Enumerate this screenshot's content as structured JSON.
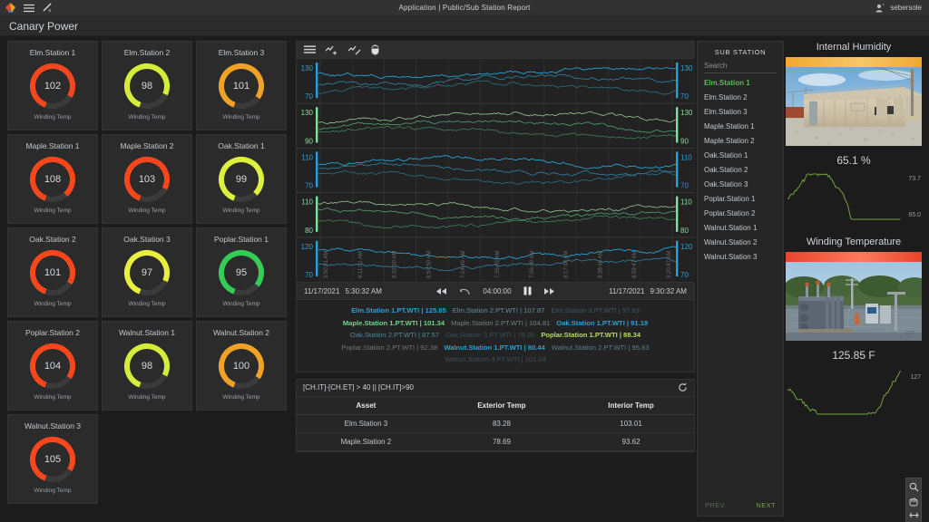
{
  "topbar": {
    "logo_icon": "canary-logo-icon",
    "menu_icon": "hamburger-menu-icon",
    "trend_icon": "trend-pen-icon",
    "title": "Application | Public/Sub Station Report",
    "user_icon": "user-account-icon",
    "user": "sebersole"
  },
  "app": {
    "title": "Canary Power"
  },
  "gauges": {
    "label": "Winding Temp",
    "items": [
      {
        "name": "Elm.Station 1",
        "value": "102",
        "color": "#f4471f",
        "pct": 78
      },
      {
        "name": "Elm.Station 2",
        "value": "98",
        "color": "#d6ec3a",
        "pct": 76
      },
      {
        "name": "Elm.Station 3",
        "value": "101",
        "color": "#f0a226",
        "pct": 79
      },
      {
        "name": "Maple.Station 1",
        "value": "108",
        "color": "#f9461c",
        "pct": 83
      },
      {
        "name": "Maple.Station 2",
        "value": "103",
        "color": "#f9461c",
        "pct": 77
      },
      {
        "name": "Oak.Station 1",
        "value": "99",
        "color": "#ddf03c",
        "pct": 82
      },
      {
        "name": "Oak.Station 2",
        "value": "101",
        "color": "#f9461c",
        "pct": 78
      },
      {
        "name": "Oak.Station 3",
        "value": "97",
        "color": "#e8ef3c",
        "pct": 76
      },
      {
        "name": "Poplar.Station 1",
        "value": "95",
        "color": "#33cc55",
        "pct": 80
      },
      {
        "name": "Poplar.Station 2",
        "value": "104",
        "color": "#f9461c",
        "pct": 79
      },
      {
        "name": "Walnut.Station 1",
        "value": "98",
        "color": "#d6ec3a",
        "pct": 77
      },
      {
        "name": "Walnut.Station 2",
        "value": "100",
        "color": "#f0a226",
        "pct": 79
      },
      {
        "name": "Walnut.Station 3",
        "value": "105",
        "color": "#f9461c",
        "pct": 78
      }
    ]
  },
  "trend": {
    "toolbar": {
      "menu_icon": "trend-menu-icon",
      "add_tag_icon": "add-trend-icon",
      "edit_tag_icon": "edit-trend-icon",
      "mouse_mode_icon": "mouse-cursor-icon"
    },
    "panels": [
      {
        "top": "130",
        "bottom": "70",
        "axis_color": "#2e9fd4"
      },
      {
        "top": "130",
        "bottom": "90",
        "axis_color": "#7fe0a0"
      },
      {
        "top": "110",
        "bottom": "70",
        "axis_color": "#2e9fd4"
      },
      {
        "top": "110",
        "bottom": "80",
        "axis_color": "#7fe0a0"
      },
      {
        "top": "120",
        "bottom": "70",
        "axis_color": "#2e9fd4"
      }
    ],
    "time_ticks": [
      "5:50:51 AM",
      "6:11:51 AM",
      "6:32:50 AM",
      "6:53:50 AM",
      "7:14:49 AM",
      "7:35:49 AM",
      "7:56:49 AM",
      "8:17:48 AM",
      "8:38:48 AM",
      "8:59:47 AM",
      "9:20:47 AM"
    ],
    "start_date": "11/17/2021",
    "start_time": "5:30:32 AM",
    "end_date": "11/17/2021",
    "end_time": "9:30:32 AM",
    "duration": "04:00:00",
    "controls": {
      "rewind_icon": "rewind-icon",
      "undo_icon": "undo-icon",
      "pause_icon": "pause-icon",
      "forward_icon": "fast-forward-icon"
    },
    "legend_rows": [
      [
        {
          "text": "Elm.Station 1.PT.WTI | 125.85",
          "color": "#2e9fd4",
          "bold": true
        },
        {
          "text": "Elm.Station 2.PT.WTI | 107.87",
          "color": "#5f8e9e",
          "bold": false
        },
        {
          "text": "Elm.Station 3.PT.WTI | 97.63",
          "color": "#3d5a66",
          "bold": false
        }
      ],
      [
        {
          "text": "Maple.Station 1.PT.WTI | 101.34",
          "color": "#6fd48a",
          "bold": true
        },
        {
          "text": "Maple.Station 2.PT.WTI | 104.81",
          "color": "#70827a",
          "bold": false
        },
        {
          "text": "Oak.Station 1.PT.WTI | 91.19",
          "color": "#2e9fd4",
          "bold": true
        }
      ],
      [
        {
          "text": "Oak.Station 2.PT.WTI | 87.57",
          "color": "#4d88a0",
          "bold": false
        },
        {
          "text": "Oak.Station 3.PT.WTI | 78.35",
          "color": "#3a4f58",
          "bold": false
        },
        {
          "text": "Poplar.Station 1.PT.WTI | 88.34",
          "color": "#b9d96b",
          "bold": true
        }
      ],
      [
        {
          "text": "Poplar.Station 2.PT.WTI | 92.38",
          "color": "#6b7a70",
          "bold": false
        },
        {
          "text": "Walnut.Station 1.PT.WTI | 80.44",
          "color": "#2e9fd4",
          "bold": true
        },
        {
          "text": "Walnut.Station 2.PT.WTI | 95.83",
          "color": "#5e7d8c",
          "bold": false
        }
      ],
      [
        {
          "text": "Walnut.Station 3.PT.WTI | 101.04",
          "color": "#3f4e52",
          "bold": false
        }
      ]
    ]
  },
  "table": {
    "expression": "[CH.IT]-[CH.ET] > 40 || [CH.IT]>90",
    "refresh_icon": "refresh-icon",
    "columns": [
      "Asset",
      "Exterior Temp",
      "Interior Temp"
    ],
    "rows": [
      [
        "Elm.Station 3",
        "83.28",
        "103.01"
      ],
      [
        "Maple.Station 2",
        "78.69",
        "93.62"
      ]
    ]
  },
  "substation": {
    "header": "SUB STATION",
    "search_placeholder": "Search",
    "items": [
      "Elm.Station 1",
      "Elm.Station 2",
      "Elm.Station 3",
      "Maple.Station 1",
      "Maple.Station 2",
      "Oak.Station 1",
      "Oak.Station 2",
      "Oak.Station 3",
      "Poplar.Station 1",
      "Poplar.Station 2",
      "Walnut.Station 1",
      "Walnut.Station 2",
      "Walnut.Station 3"
    ],
    "active_index": 0,
    "prev_label": "PREV",
    "next_label": "NEXT"
  },
  "right": {
    "humidity": {
      "title": "Internal Humidity",
      "bar_color": "#f0a830",
      "value": "65.1 %",
      "spark_color": "#74a03a",
      "axis_top": "73.7",
      "axis_bottom": "65.0",
      "photo_name": "substation-building-photo"
    },
    "winding": {
      "title": "Winding Temperature",
      "bar_color": "#e8452a",
      "value": "125.85 F",
      "spark_color": "#74a03a",
      "axis_top": "127",
      "photo_name": "transformer-photo"
    },
    "float_tools": {
      "zoom_icon": "magnifier-icon",
      "pan_icon": "pan-icon",
      "width_icon": "fit-width-icon"
    }
  }
}
